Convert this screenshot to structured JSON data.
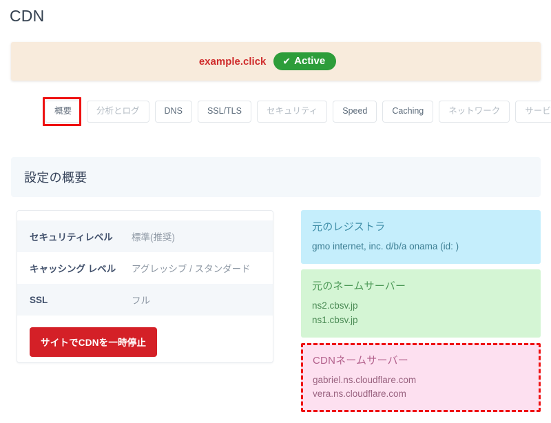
{
  "page": {
    "title": "CDN"
  },
  "banner": {
    "domain": "example.click",
    "status_label": "Active",
    "status_icon": "check-icon",
    "status_color": "#2d9d3a",
    "background_color": "#f8ebdc",
    "domain_color": "#cf2b2b"
  },
  "tabs": [
    {
      "label": "概要",
      "state": "active",
      "highlighted": true
    },
    {
      "label": "分析とログ",
      "state": "muted",
      "highlighted": false
    },
    {
      "label": "DNS",
      "state": "normal",
      "highlighted": false
    },
    {
      "label": "SSL/TLS",
      "state": "normal",
      "highlighted": false
    },
    {
      "label": "セキュリティ",
      "state": "muted",
      "highlighted": false
    },
    {
      "label": "Speed",
      "state": "normal",
      "highlighted": false
    },
    {
      "label": "Caching",
      "state": "normal",
      "highlighted": false
    },
    {
      "label": "ネットワーク",
      "state": "muted",
      "highlighted": false
    },
    {
      "label": "サービスに戻る",
      "state": "muted",
      "highlighted": false
    }
  ],
  "section": {
    "heading": "設定の概要"
  },
  "settings": {
    "rows": [
      {
        "label": "セキュリティレベル",
        "value": "標準(推奨)"
      },
      {
        "label": "キャッシング レベル",
        "value": "アグレッシブ / スタンダード"
      },
      {
        "label": "SSL",
        "value": "フル"
      }
    ],
    "pause_button_label": "サイトでCDNを一時停止",
    "pause_button_color": "#d42027"
  },
  "info_cards": [
    {
      "heading": "元のレジストラ",
      "lines": [
        "gmo internet, inc. d/b/a onama (id: )"
      ],
      "background_color": "#c5eefc",
      "highlighted": false
    },
    {
      "heading": "元のネームサーバー",
      "lines": [
        "ns2.cbsv.jp",
        "ns1.cbsv.jp"
      ],
      "background_color": "#d4f5d4",
      "highlighted": false
    },
    {
      "heading": "CDNネームサーバー",
      "lines": [
        "gabriel.ns.cloudflare.com",
        "vera.ns.cloudflare.com"
      ],
      "background_color": "#fde0f0",
      "highlighted": true,
      "highlight_color": "#ee1111"
    }
  ]
}
